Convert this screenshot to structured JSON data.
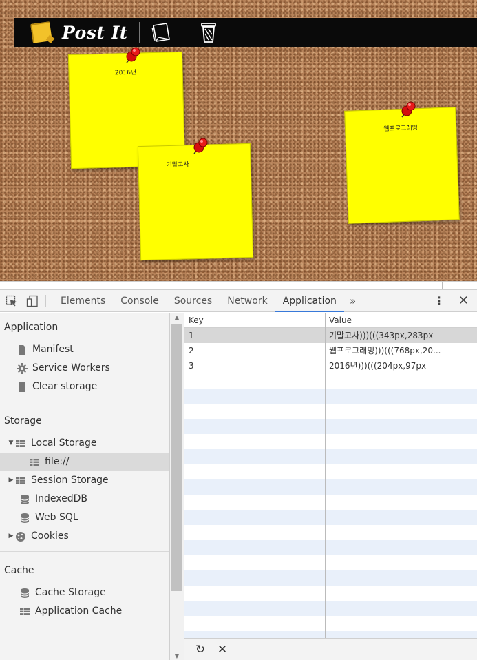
{
  "app": {
    "title": "Post It",
    "new_note_icon": "new-note-icon",
    "trash_icon": "trash-icon",
    "note_color": "#ffff00",
    "pin_color": "#e01010"
  },
  "notes": [
    {
      "title": "2016년"
    },
    {
      "title": "기말고사"
    },
    {
      "title": "웹프로그래밍"
    }
  ],
  "devtools": {
    "tabs": [
      "Elements",
      "Console",
      "Sources",
      "Network",
      "Application"
    ],
    "active_tab": "Application",
    "more_label": "»",
    "kebab_label": "⋮",
    "close_label": "✕",
    "sidebar": {
      "application_header": "Application",
      "application_items": [
        "Manifest",
        "Service Workers",
        "Clear storage"
      ],
      "storage_header": "Storage",
      "local_storage": "Local Storage",
      "local_storage_child": "file://",
      "session_storage": "Session Storage",
      "indexeddb": "IndexedDB",
      "web_sql": "Web SQL",
      "cookies": "Cookies",
      "cache_header": "Cache",
      "cache_storage": "Cache Storage",
      "application_cache": "Application Cache"
    },
    "table": {
      "headers": {
        "key": "Key",
        "value": "Value"
      },
      "rows": [
        {
          "key": "1",
          "value": "기말고사)))(((343px,283px"
        },
        {
          "key": "2",
          "value": "웹프로그래밍)))(((768px,20..."
        },
        {
          "key": "3",
          "value": "2016년)))(((204px,97px"
        }
      ]
    },
    "footer": {
      "refresh_label": "↻",
      "clear_label": "✕"
    }
  }
}
